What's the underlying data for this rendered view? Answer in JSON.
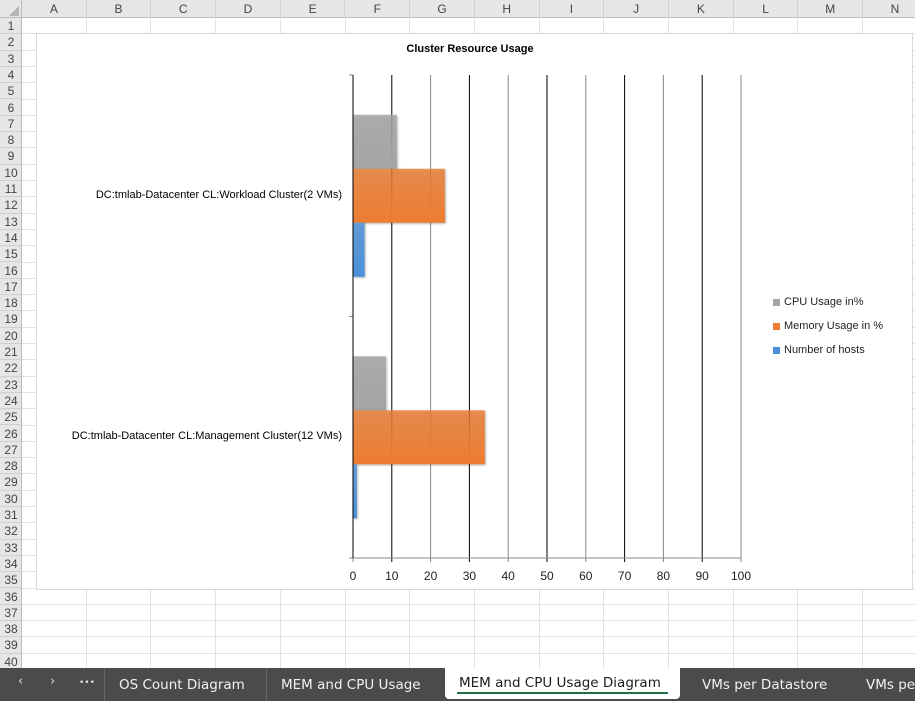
{
  "columns": [
    "A",
    "B",
    "C",
    "D",
    "E",
    "F",
    "G",
    "H",
    "I",
    "J",
    "K",
    "L",
    "M",
    "N"
  ],
  "row_count": 40,
  "chart_data": {
    "type": "bar",
    "orientation": "horizontal",
    "title": "Cluster Resource Usage",
    "categories": [
      "DC:tmlab-Datacenter CL:Workload Cluster(2 VMs)",
      "DC:tmlab-Datacenter CL:Management Cluster(12 VMs)"
    ],
    "series": [
      {
        "name": "CPU Usage in%",
        "color": "#a5a5a5",
        "values": [
          11.3,
          8.5
        ]
      },
      {
        "name": "Memory Usage in %",
        "color": "#ed7d31",
        "values": [
          23.7,
          34
        ]
      },
      {
        "name": "Number of hosts",
        "color": "#4a90d9",
        "values": [
          3,
          1
        ]
      }
    ],
    "xlim": [
      0,
      100
    ],
    "xticks": [
      "0",
      "10",
      "20",
      "30",
      "40",
      "50",
      "60",
      "70",
      "80",
      "90",
      "100"
    ],
    "grid": true,
    "legend": "right"
  },
  "sheet_tabs": {
    "nav": {
      "prev": "‹",
      "next": "›",
      "more": "•••"
    },
    "tabs": [
      "OS Count Diagram",
      "MEM and CPU Usage",
      "MEM and CPU Usage Diagram",
      "VMs per Datastore",
      "VMs pe"
    ],
    "active": 2
  }
}
